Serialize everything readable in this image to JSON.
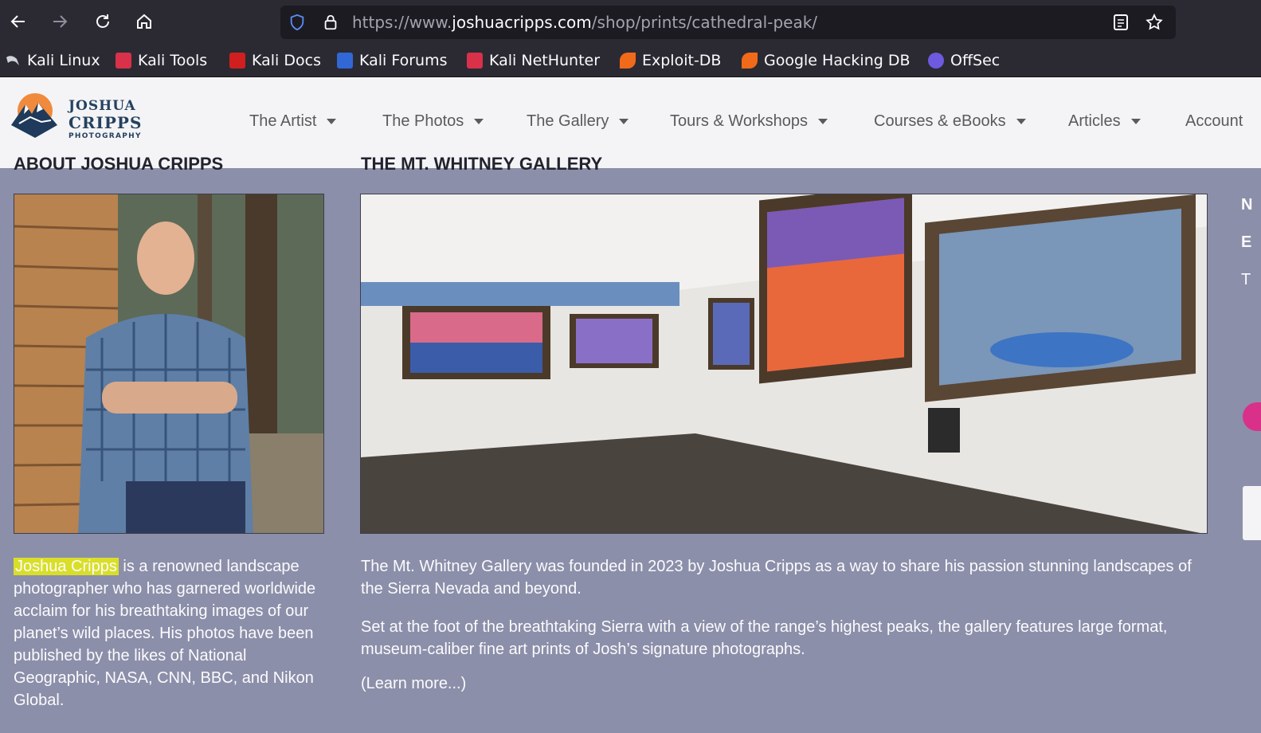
{
  "browser": {
    "url_prefix": "https://www.",
    "url_host": "joshuacripps.com",
    "url_path": "/shop/prints/cathedral-peak/",
    "bookmarks": [
      {
        "label": "Kali Linux",
        "color": "#1f8fe6"
      },
      {
        "label": "Kali Tools",
        "color": "#d9314a"
      },
      {
        "label": "Kali Docs",
        "color": "#d11f1f"
      },
      {
        "label": "Kali Forums",
        "color": "#3267d6"
      },
      {
        "label": "Kali NetHunter",
        "color": "#d9314a"
      },
      {
        "label": "Exploit-DB",
        "color": "#f06a1a"
      },
      {
        "label": "Google Hacking DB",
        "color": "#f06a1a"
      },
      {
        "label": "OffSec",
        "color": "#6d5ae0"
      }
    ]
  },
  "site": {
    "logo": {
      "line1": "JOSHUA",
      "line2": "CRIPPS",
      "line3": "PHOTOGRAPHY"
    },
    "nav": [
      {
        "label": "The Artist"
      },
      {
        "label": "The Photos"
      },
      {
        "label": "The Gallery"
      },
      {
        "label": "Tours & Workshops"
      },
      {
        "label": "Courses & eBooks"
      },
      {
        "label": "Articles"
      },
      {
        "label": "Account"
      }
    ]
  },
  "content": {
    "left_heading": "ABOUT JOSHUA CRIPPS",
    "right_heading": "THE MT. WHITNEY GALLERY",
    "about_name": "Joshua Cripps",
    "about_text": " is a renowned landscape photographer who has garnered worldwide acclaim for his breathtaking images of our planet’s wild places. His photos have been published by the likes of National Geographic, NASA, CNN, BBC, and Nikon Global.",
    "gallery_p1": "The Mt. Whitney Gallery was founded in 2023 by Joshua Cripps as a way to share his passion stunning landscapes of the Sierra Nevada and beyond.",
    "gallery_p2": "Set at the foot of the breathtaking Sierra with a view of the range’s highest peaks, the gallery features large format, museum-caliber fine art prints of Josh’s signature photographs.",
    "learn_more": "(Learn more...)"
  },
  "colors": {
    "highlight": "#d9df28",
    "page_bg": "#8c8fa9",
    "brand_navy": "#25415f"
  }
}
